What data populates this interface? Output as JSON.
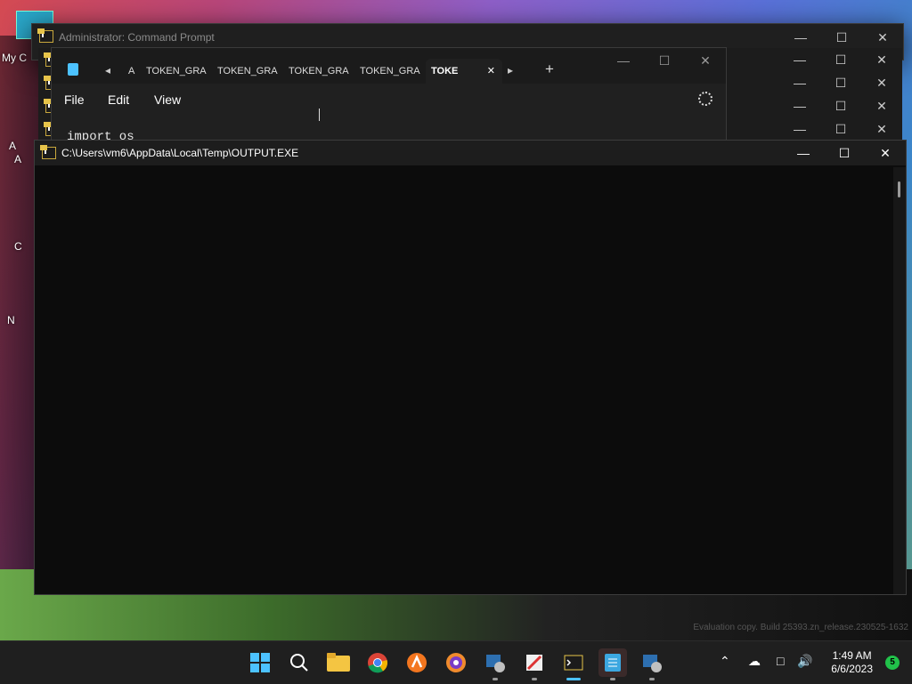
{
  "desktop": {
    "icon_labels": [
      "My C",
      "A",
      "A",
      "C",
      "N"
    ],
    "watermark": "Evaluation copy. Build 25393.zn_release.230525-1632"
  },
  "windows": {
    "admin_cmd": {
      "title": "Administrator:  Command Prompt",
      "minimize": "—",
      "maximize": "☐",
      "close": "✕"
    },
    "stacked_cmd_count": 4,
    "output": {
      "title": "C:\\Users\\vm6\\AppData\\Local\\Temp\\OUTPUT.EXE",
      "minimize": "—",
      "maximize": "☐",
      "close": "✕"
    }
  },
  "notepad": {
    "tabs": [
      "A",
      "TOKEN_GRA",
      "TOKEN_GRA",
      "TOKEN_GRA",
      "TOKEN_GRA",
      "TOKEN_GRA"
    ],
    "active_tab": "TOKE",
    "tab_close": "✕",
    "add_tab": "+",
    "scroll_left": "◂",
    "scroll_right": "▸",
    "menu": {
      "file": "File",
      "edit": "Edit",
      "view": "View"
    },
    "content": "import os",
    "minimize": "—",
    "maximize": "☐",
    "close": "✕"
  },
  "taskbar": {
    "apps": [
      "start",
      "search",
      "file-explorer",
      "chrome",
      "avast",
      "brave",
      "cmd-settings",
      "paint",
      "command-prompt",
      "notepad",
      "cmd-settings-2"
    ],
    "clock_time": "1:49 AM",
    "clock_date": "6/6/2023",
    "notification_count": "5"
  },
  "colors": {
    "accent": "#4cc2ff",
    "titlebar": "#1f1f1f",
    "console_bg": "#0c0c0c"
  }
}
